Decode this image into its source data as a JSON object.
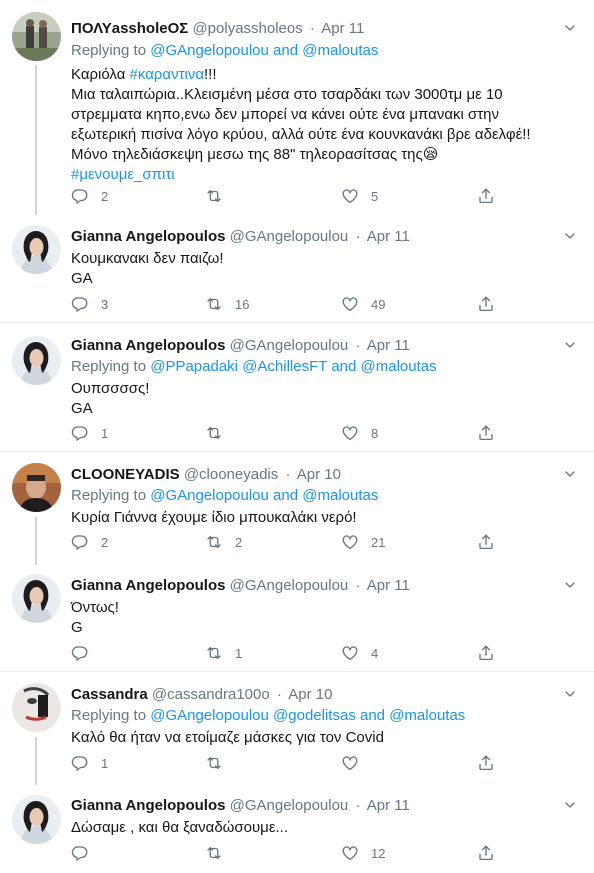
{
  "tweets": [
    {
      "name": "ΠΟΛΥassholeΟΣ",
      "handle": "@polyassholeos",
      "date": "Apr 11",
      "replying_prefix": "Replying to",
      "reply_user1": "@GAngelopoulou",
      "reply_and": "and",
      "reply_user2": "@maloutas",
      "line1_a": "Καριόλα ",
      "line1_hashtag": "#καραντινα",
      "line1_b": "!!!",
      "line2": "Μια ταλαιπώρια..Κλεισμένη μέσα στο τσαρδάκι των 3000τμ με 10",
      "line3": "στρεμματα κηπο,ενω δεν μπορεί να κάνει ούτε ένα μπανακι στην",
      "line4": "εξωτερική πισίνα λόγο κρύου, αλλά ούτε ένα κουνκανάκι βρε αδελφέ!!",
      "line5": "Μόνο τηλεδιάσκεψη μεσω της 88\" τηλεορασίτσας της😪",
      "line6_hashtag": "#μενουμε_σπιτι",
      "replies": "2",
      "retweets": "",
      "likes": "5"
    },
    {
      "name": "Gianna Angelopoulos",
      "handle": "@GAngelopoulou",
      "date": "Apr 11",
      "line1": "Κουμκανακι δεν παιζω!",
      "line2": "GA",
      "replies": "3",
      "retweets": "16",
      "likes": "49"
    },
    {
      "name": "Gianna Angelopoulos",
      "handle": "@GAngelopoulou",
      "date": "Apr 11",
      "replying_prefix": "Replying to",
      "reply_user1": "@PPapadaki",
      "reply_user2": "@AchillesFT",
      "reply_and": "and",
      "reply_user3": "@maloutas",
      "line1": "Ουπσσσσς!",
      "line2": "GA",
      "replies": "1",
      "retweets": "",
      "likes": "8"
    },
    {
      "name": "CLOONEYADIS",
      "handle": "@clooneyadis",
      "date": "Apr 10",
      "replying_prefix": "Replying to",
      "reply_user1": "@GAngelopoulou",
      "reply_and": "and",
      "reply_user2": "@maloutas",
      "line1": "Κυρία Γιάννα έχουμε ίδιο μπουκαλάκι νερό!",
      "replies": "2",
      "retweets": "2",
      "likes": "21"
    },
    {
      "name": "Gianna Angelopoulos",
      "handle": "@GAngelopoulou",
      "date": "Apr 11",
      "line1": "Όντως!",
      "line2": "G",
      "replies": "",
      "retweets": "1",
      "likes": "4"
    },
    {
      "name": "Cassandra",
      "handle": "@cassandra100o",
      "date": "Apr 10",
      "replying_prefix": "Replying to",
      "reply_user1": "@GAngelopoulou",
      "reply_user2": "@godelitsas",
      "reply_and": "and",
      "reply_user3": "@maloutas",
      "line1": "Καλό θα ήταν να ετοίμαζε μάσκες για τον Covid",
      "replies": "1",
      "retweets": "",
      "likes": ""
    },
    {
      "name": "Gianna Angelopoulos",
      "handle": "@GAngelopoulou",
      "date": "Apr 11",
      "line1": "Δώσαμε , και θα ξαναδώσουμε...",
      "replies": "",
      "retweets": "",
      "likes": "12"
    }
  ],
  "ui": {
    "dot": "·",
    "icons": [
      "reply-icon",
      "retweet-icon",
      "like-icon",
      "share-icon",
      "chevron-down-icon"
    ],
    "colors": {
      "link": "#1b95e0",
      "muted": "#657786",
      "border": "#e6ecf0",
      "thread": "#ccd6dd"
    }
  }
}
